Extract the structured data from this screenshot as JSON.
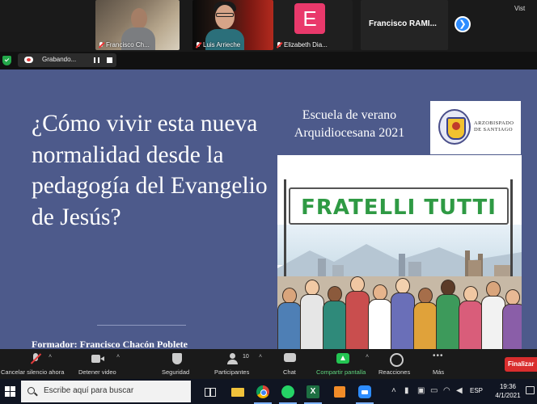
{
  "participants": [
    {
      "name": "Francisco Ch..."
    },
    {
      "name": "Luis Arrieche"
    },
    {
      "name": "Elizabeth Dia...",
      "initial": "E"
    },
    {
      "name": "Francisco RAMI..."
    }
  ],
  "view_label": "Vist",
  "recording": {
    "label": "Grabando..."
  },
  "slide": {
    "question": "¿Cómo vivir esta nueva normalidad desde la pedagogía del Evangelio de Jesús?",
    "formador": "Formador: Francisco Chacón Poblete",
    "school_title_line1": "Escuela de verano",
    "school_title_line2": "Arquidiocesana 2021",
    "arzobispado_line1": "ARZOBISPADO",
    "arzobispado_line2": "DE SANTIAGO",
    "banner_text": "FRATELLI TUTTI"
  },
  "toolbar": {
    "unmute": "Cancelar silencio ahora",
    "stop_video": "Detener video",
    "security": "Seguridad",
    "participants": "Participantes",
    "participants_count": "10",
    "chat": "Chat",
    "share": "Compartir pantalla",
    "reactions": "Reacciones",
    "more": "Más",
    "end": "Finalizar"
  },
  "taskbar": {
    "search_placeholder": "Escribe aquí para buscar",
    "language": "ESP",
    "time": "19:36",
    "date": "4/1/2021"
  },
  "colors": {
    "slide_bg": "#4d5a8b",
    "banner_green": "#2f9a44",
    "share_green": "#23c552",
    "end_red": "#d92d2d",
    "zoom_blue": "#2d8cff"
  }
}
